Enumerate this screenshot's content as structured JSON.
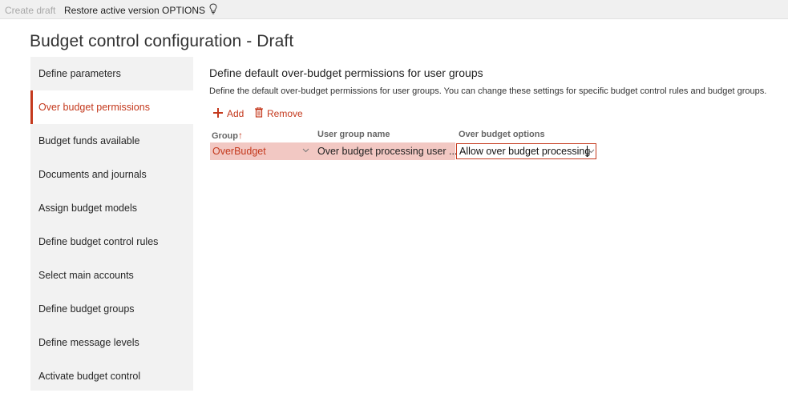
{
  "toolbar": {
    "create_draft": "Create draft",
    "restore_active_version": "Restore active version",
    "options": "OPTIONS",
    "bulb_icon": "lightbulb-icon"
  },
  "page": {
    "title": "Budget control configuration - Draft"
  },
  "sidebar": {
    "items": [
      {
        "label": "Define parameters"
      },
      {
        "label": "Over budget permissions",
        "active": true
      },
      {
        "label": "Budget funds available"
      },
      {
        "label": "Documents and journals"
      },
      {
        "label": "Assign budget models"
      },
      {
        "label": "Define budget control rules"
      },
      {
        "label": "Select main accounts"
      },
      {
        "label": "Define budget groups"
      },
      {
        "label": "Define message levels"
      },
      {
        "label": "Activate budget control"
      }
    ]
  },
  "main": {
    "title": "Define default over-budget permissions for user groups",
    "description": "Define the default over-budget permissions for user groups. You can change these settings for specific budget control rules and budget groups.",
    "actions": {
      "add": "Add",
      "remove": "Remove"
    },
    "grid": {
      "headers": {
        "group": "Group",
        "user_group_name": "User group name",
        "over_budget_options": "Over budget options"
      },
      "rows": [
        {
          "group": "OverBudget",
          "user_group_name": "Over budget processing user ...",
          "over_budget_options": "Allow over budget processing"
        }
      ]
    }
  },
  "colors": {
    "accent": "#c4391d",
    "row_selected": "#f2c8c3",
    "sidebar_bg": "#f2f2f2",
    "toolbar_bg": "#f0f0f0"
  }
}
